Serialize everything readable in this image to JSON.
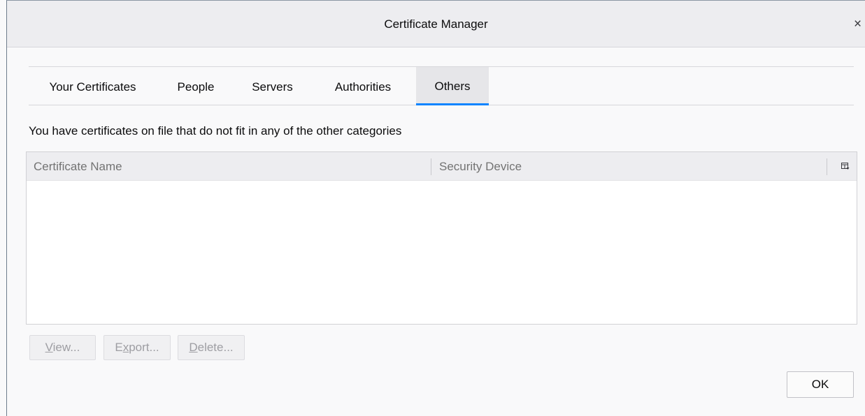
{
  "window": {
    "title": "Certificate Manager",
    "close_glyph": "×"
  },
  "tabs": [
    {
      "label": "Your Certificates",
      "selected": false
    },
    {
      "label": "People",
      "selected": false
    },
    {
      "label": "Servers",
      "selected": false
    },
    {
      "label": "Authorities",
      "selected": false
    },
    {
      "label": "Others",
      "selected": true
    }
  ],
  "description": "You have certificates on file that do not fit in any of the other categories",
  "table": {
    "columns": [
      "Certificate Name",
      "Security Device"
    ],
    "rows": []
  },
  "buttons": {
    "view": {
      "prefix": "",
      "accel": "V",
      "suffix": "iew..."
    },
    "export": {
      "prefix": "E",
      "accel": "x",
      "suffix": "port..."
    },
    "delete": {
      "prefix": "",
      "accel": "D",
      "suffix": "elete..."
    },
    "ok": "OK"
  },
  "colors": {
    "accent": "#0a84ff"
  }
}
